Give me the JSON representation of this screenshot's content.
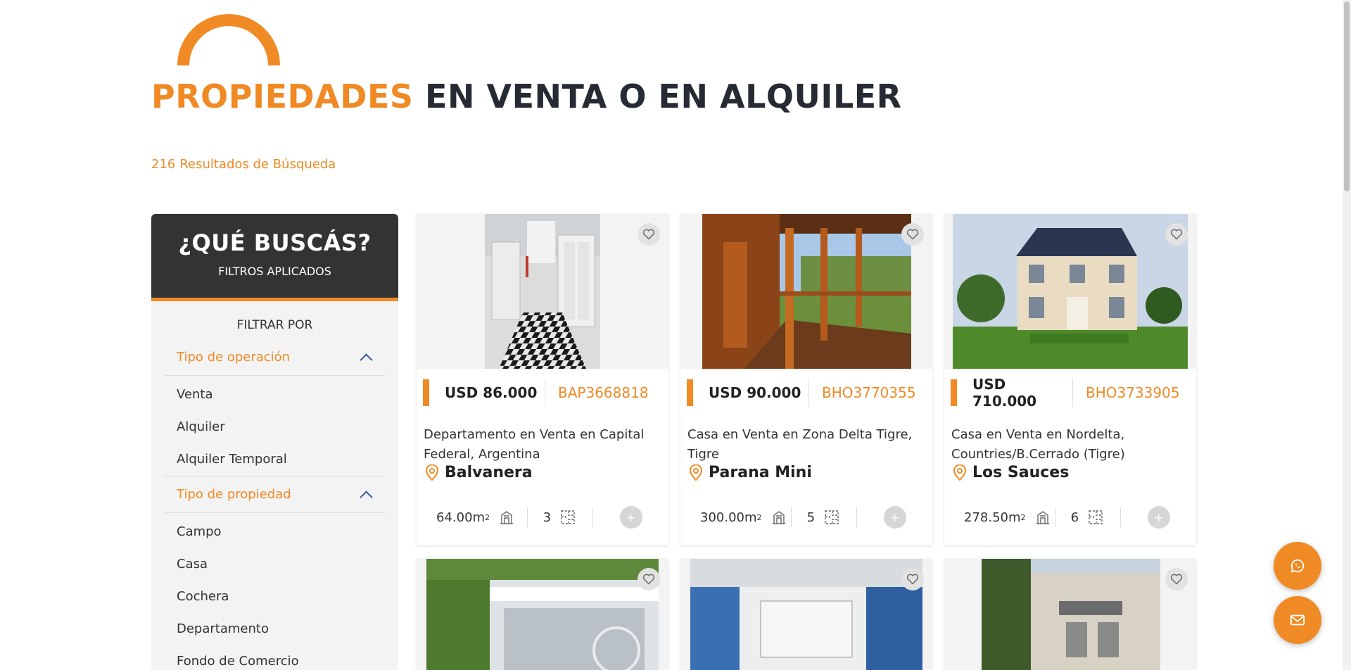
{
  "header": {
    "title_accent": "PROPIEDADES",
    "title_rest": "EN VENTA O EN ALQUILER",
    "results_count": "216",
    "results_label": "Resultados de Búsqueda"
  },
  "sidebar": {
    "title": "¿QUÉ BUSCÁS?",
    "subtitle": "FILTROS APLICADOS",
    "filter_by": "FILTRAR POR",
    "groups": [
      {
        "label": "Tipo de operación",
        "options": [
          "Venta",
          "Alquiler",
          "Alquiler Temporal"
        ]
      },
      {
        "label": "Tipo de propiedad",
        "options": [
          "Campo",
          "Casa",
          "Cochera",
          "Departamento",
          "Fondo de Comercio"
        ]
      }
    ]
  },
  "listings": [
    {
      "price": "USD 86.000",
      "code": "BAP3668818",
      "title": "Departamento en Venta en Capital Federal, Argentina",
      "location": "Balvanera",
      "area": "64.00m",
      "area_unit_sup": "2",
      "rooms": "3"
    },
    {
      "price": "USD 90.000",
      "code": "BHO3770355",
      "title": "Casa en Venta en Zona Delta Tigre, Tigre",
      "location": "Parana Mini",
      "area": "300.00m",
      "area_unit_sup": "2",
      "rooms": "5"
    },
    {
      "price": "USD 710.000",
      "code": "BHO3733905",
      "title": "Casa en Venta en Nordelta, Countries/B.Cerrado (Tigre)",
      "location": "Los Sauces",
      "area": "278.50m",
      "area_unit_sup": "2",
      "rooms": "6"
    }
  ],
  "plus_label": "+",
  "colors": {
    "accent": "#f08a24",
    "dark": "#333333",
    "sidebar_bg": "#f3f3f3"
  },
  "icons": {
    "favorite": "heart-icon",
    "location": "map-pin-icon",
    "area": "building-area-icon",
    "rooms": "floor-plan-icon",
    "whatsapp": "whatsapp-icon",
    "mail": "mail-icon"
  }
}
